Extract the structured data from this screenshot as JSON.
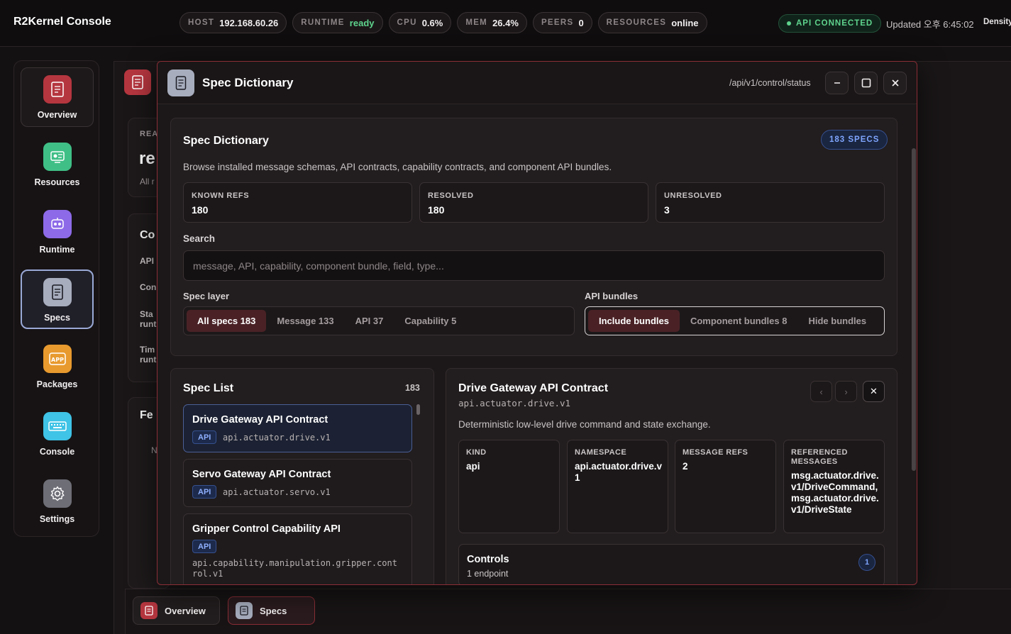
{
  "app": {
    "title": "R2Kernel Console"
  },
  "status": {
    "chips": [
      {
        "key": "HOST",
        "value": "192.168.60.26",
        "accent": ""
      },
      {
        "key": "RUNTIME",
        "value": "ready",
        "accent": "green"
      },
      {
        "key": "CPU",
        "value": "0.6%",
        "accent": ""
      },
      {
        "key": "MEM",
        "value": "26.4%",
        "accent": ""
      },
      {
        "key": "PEERS",
        "value": "0",
        "accent": ""
      },
      {
        "key": "RESOURCES",
        "value": "online",
        "accent": ""
      }
    ],
    "api": "API CONNECTED",
    "updated": "Updated 오후 6:45:02",
    "density": "Density"
  },
  "sidebar": {
    "items": [
      {
        "label": "Overview",
        "icon": "document-icon",
        "color": "#b5363f"
      },
      {
        "label": "Resources",
        "icon": "resources-icon",
        "color": "#3fbf86"
      },
      {
        "label": "Runtime",
        "icon": "runtime-icon",
        "color": "#8d6ae8"
      },
      {
        "label": "Specs",
        "icon": "specs-icon",
        "color": "#a7adbd"
      },
      {
        "label": "Packages",
        "icon": "app-icon",
        "color": "#e89a2e"
      },
      {
        "label": "Console",
        "icon": "keyboard-icon",
        "color": "#3fc3e6"
      },
      {
        "label": "Settings",
        "icon": "gear-icon",
        "color": "#7a7a82"
      }
    ]
  },
  "background": {
    "fragments": [
      "REA",
      "re",
      "All r",
      "Co",
      "API",
      "Con",
      "Sta",
      "runt",
      "Tim",
      "runt",
      "Fe",
      "N"
    ]
  },
  "dock": {
    "items": [
      {
        "label": "Overview"
      },
      {
        "label": "Specs"
      }
    ]
  },
  "modal": {
    "title": "Spec Dictionary",
    "path": "/api/v1/control/status",
    "buttons": {
      "minimize": "–",
      "maximize": "☐",
      "close": "✕"
    }
  },
  "dictionary": {
    "title": "Spec Dictionary",
    "badge": "183 SPECS",
    "description": "Browse installed message schemas, API contracts, capability contracts, and component API bundles.",
    "stats": [
      {
        "label": "KNOWN REFS",
        "value": "180"
      },
      {
        "label": "RESOLVED",
        "value": "180"
      },
      {
        "label": "UNRESOLVED",
        "value": "3"
      }
    ],
    "search_label": "Search",
    "search_placeholder": "message, API, capability, component bundle, field, type...",
    "layer_label": "Spec layer",
    "layers": [
      "All specs 183",
      "Message 133",
      "API 37",
      "Capability 5"
    ],
    "bundles_label": "API bundles",
    "bundles": [
      "Include bundles",
      "Component bundles 8",
      "Hide bundles"
    ]
  },
  "spec_list": {
    "title": "Spec List",
    "count": "183",
    "items": [
      {
        "title": "Drive Gateway API Contract",
        "tag": "API",
        "id": "api.actuator.drive.v1"
      },
      {
        "title": "Servo Gateway API Contract",
        "tag": "API",
        "id": "api.actuator.servo.v1"
      },
      {
        "title": "Gripper Control Capability API",
        "tag": "API",
        "id": "api.capability.manipulation.gripper.control.v1"
      }
    ]
  },
  "detail": {
    "title": "Drive Gateway API Contract",
    "id": "api.actuator.drive.v1",
    "description": "Deterministic low-level drive command and state exchange.",
    "nav": {
      "prev": "‹",
      "next": "›",
      "close": "✕"
    },
    "fields": [
      {
        "label": "KIND",
        "value": "api"
      },
      {
        "label": "NAMESPACE",
        "value": "api.actuator.drive.v1"
      },
      {
        "label": "MESSAGE REFS",
        "value": "2"
      },
      {
        "label": "REFERENCED MESSAGES",
        "value": "msg.actuator.drive.v1/DriveCommand, msg.actuator.drive.v1/DriveState"
      }
    ],
    "controls": {
      "title": "Controls",
      "subtitle": "1 endpoint",
      "count": "1"
    }
  }
}
